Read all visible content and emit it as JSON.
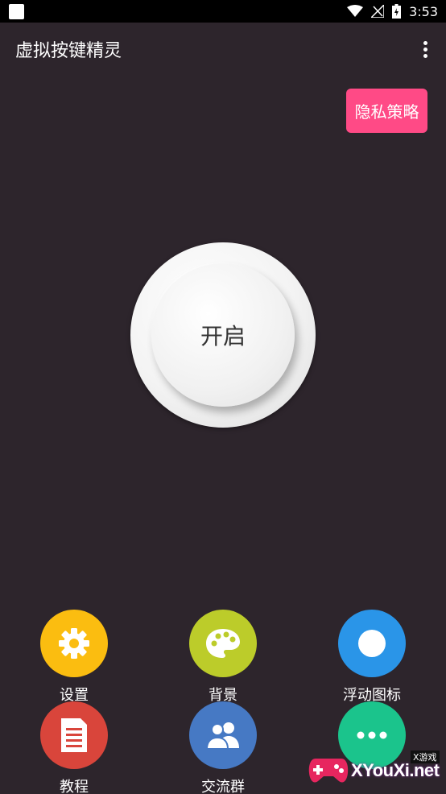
{
  "statusbar": {
    "time": "3:53"
  },
  "appbar": {
    "title": "虚拟按键精灵"
  },
  "privacy_button": {
    "label": "隐私策略"
  },
  "power_button": {
    "label": "开启"
  },
  "grid": [
    {
      "label": "设置",
      "icon": "gear-icon",
      "color": "#fbbd10"
    },
    {
      "label": "背景",
      "icon": "palette-icon",
      "color": "#bccc2a"
    },
    {
      "label": "浮动图标",
      "icon": "dot-icon",
      "color": "#2a95e8"
    },
    {
      "label": "教程",
      "icon": "document-icon",
      "color": "#d9453b"
    },
    {
      "label": "交流群",
      "icon": "group-icon",
      "color": "#4679c4"
    },
    {
      "label": "",
      "icon": "more-icon",
      "color": "#1bc48c"
    }
  ],
  "watermark": {
    "tag": "X游戏",
    "text": "XYouXi.net"
  }
}
